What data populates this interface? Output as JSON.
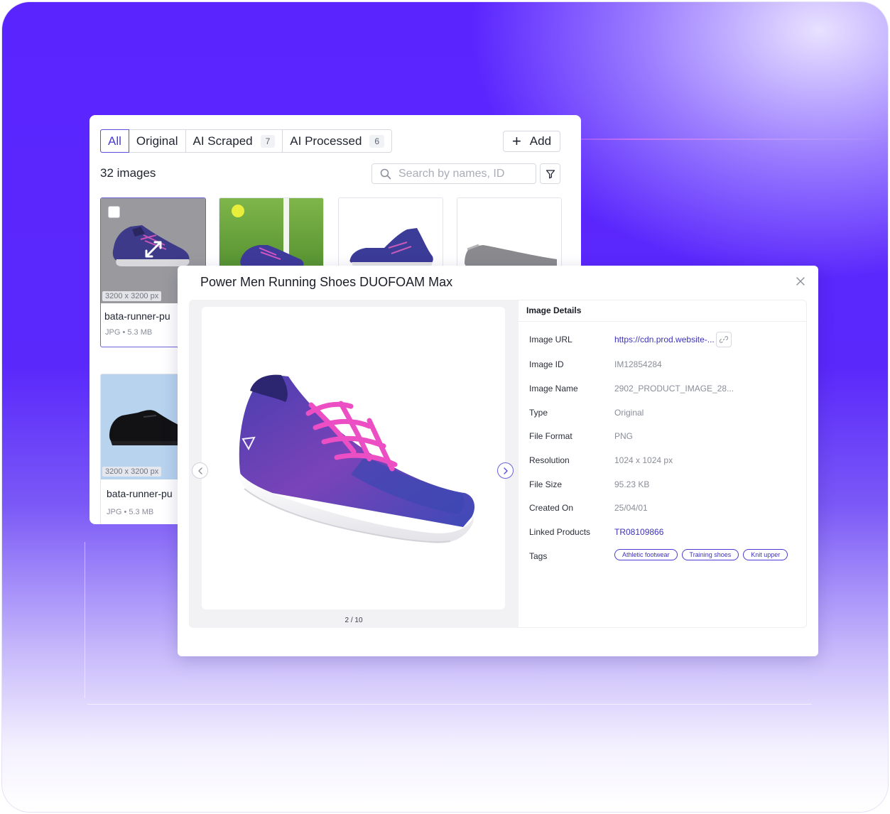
{
  "gallery": {
    "tabs": [
      {
        "label": "All",
        "count": ""
      },
      {
        "label": "Original",
        "count": ""
      },
      {
        "label": "AI Scraped",
        "count": "7"
      },
      {
        "label": "AI Processed",
        "count": "6"
      }
    ],
    "add_label": "Add",
    "image_count": "32 images",
    "search_placeholder": "Search by names, ID",
    "cards": [
      {
        "resolution": "3200 x 3200 px",
        "name": "bata-runner-pu",
        "format": "JPG",
        "size": "5.3 MB"
      },
      {
        "resolution": "3200 x 3200 px",
        "name": "bata-runner-pu",
        "format": "JPG",
        "size": "5.3 MB"
      }
    ]
  },
  "modal": {
    "title": "Power Men Running Shoes DUOFOAM Max",
    "page_indicator": "2 / 10",
    "details_heading": "Image Details",
    "details": {
      "image_url": {
        "label": "Image URL",
        "value": "https://cdn.prod.website-..."
      },
      "image_id": {
        "label": "Image ID",
        "value": "IM12854284"
      },
      "image_name": {
        "label": "Image Name",
        "value": "2902_PRODUCT_IMAGE_28..."
      },
      "type": {
        "label": "Type",
        "value": "Original"
      },
      "file_format": {
        "label": "File Format",
        "value": "PNG"
      },
      "resolution": {
        "label": "Resolution",
        "value": "1024 x 1024 px"
      },
      "file_size": {
        "label": "File Size",
        "value": "95.23 KB"
      },
      "created_on": {
        "label": "Created On",
        "value": "25/04/01"
      },
      "linked_products": {
        "label": "Linked Products",
        "value": "TR08109866"
      },
      "tags": {
        "label": "Tags",
        "values": [
          "Athletic footwear",
          "Training shoes",
          "Knit upper"
        ]
      }
    }
  },
  "colors": {
    "accent": "#5b4ee0",
    "link": "#3d33b8",
    "background": "#5a24ff"
  }
}
